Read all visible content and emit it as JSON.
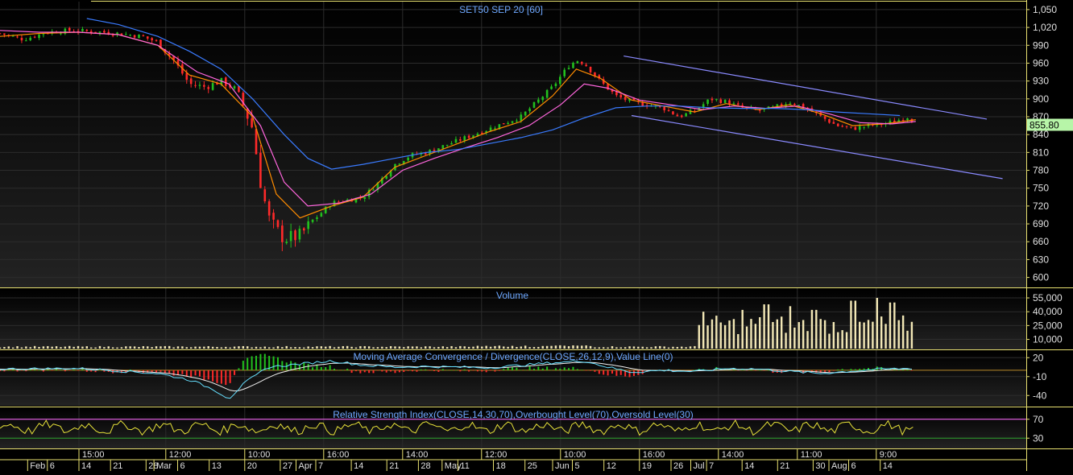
{
  "chart_data": [
    {
      "type": "candlestick",
      "title": "SET50 SEP 20   [60]",
      "last_price": 855.8,
      "last_price_label": "855.80",
      "ylim": [
        590,
        1058
      ],
      "y_ticks": [
        1050,
        1020,
        990,
        960,
        930,
        900,
        870,
        840,
        810,
        780,
        750,
        720,
        690,
        660,
        630,
        600
      ],
      "y_tick_labels": [
        "1,050",
        "1,020",
        "990",
        "960",
        "930",
        "900",
        "870",
        "840",
        "810",
        "780",
        "750",
        "720",
        "690",
        "660",
        "630",
        "600"
      ],
      "close_path": [
        [
          0,
          1010
        ],
        [
          3,
          1000
        ],
        [
          6,
          1012
        ],
        [
          9,
          1015
        ],
        [
          12,
          1013
        ],
        [
          15,
          1010
        ],
        [
          18,
          1005
        ],
        [
          20,
          995
        ],
        [
          22,
          965
        ],
        [
          24,
          925
        ],
        [
          26,
          920
        ],
        [
          28,
          930
        ],
        [
          30,
          915
        ],
        [
          32,
          850
        ],
        [
          33,
          760
        ],
        [
          34,
          700
        ],
        [
          35,
          680
        ],
        [
          36,
          665
        ],
        [
          38,
          670
        ],
        [
          40,
          700
        ],
        [
          42,
          725
        ],
        [
          44,
          730
        ],
        [
          46,
          735
        ],
        [
          48,
          760
        ],
        [
          50,
          790
        ],
        [
          52,
          805
        ],
        [
          54,
          810
        ],
        [
          56,
          820
        ],
        [
          58,
          830
        ],
        [
          60,
          840
        ],
        [
          62,
          850
        ],
        [
          64,
          860
        ],
        [
          66,
          870
        ],
        [
          68,
          895
        ],
        [
          70,
          920
        ],
        [
          72,
          955
        ],
        [
          73,
          965
        ],
        [
          74,
          960
        ],
        [
          76,
          930
        ],
        [
          78,
          905
        ],
        [
          80,
          895
        ],
        [
          82,
          890
        ],
        [
          84,
          885
        ],
        [
          86,
          870
        ],
        [
          88,
          880
        ],
        [
          90,
          900
        ],
        [
          92,
          895
        ],
        [
          94,
          885
        ],
        [
          96,
          880
        ],
        [
          98,
          885
        ],
        [
          100,
          895
        ],
        [
          102,
          885
        ],
        [
          104,
          870
        ],
        [
          106,
          855
        ],
        [
          108,
          850
        ],
        [
          110,
          855
        ],
        [
          112,
          858
        ],
        [
          114,
          865
        ],
        [
          115,
          870
        ],
        [
          116,
          860
        ]
      ],
      "ma_series": [
        {
          "color": "#ff8c00",
          "points": [
            [
              0,
              1005
            ],
            [
              5,
              1010
            ],
            [
              10,
              1012
            ],
            [
              15,
              1008
            ],
            [
              20,
              990
            ],
            [
              24,
              940
            ],
            [
              28,
              925
            ],
            [
              32,
              870
            ],
            [
              35,
              740
            ],
            [
              38,
              700
            ],
            [
              42,
              720
            ],
            [
              46,
              735
            ],
            [
              50,
              785
            ],
            [
              54,
              805
            ],
            [
              58,
              825
            ],
            [
              62,
              845
            ],
            [
              66,
              862
            ],
            [
              70,
              905
            ],
            [
              73,
              950
            ],
            [
              76,
              935
            ],
            [
              80,
              898
            ],
            [
              84,
              888
            ],
            [
              88,
              878
            ],
            [
              92,
              892
            ],
            [
              96,
              882
            ],
            [
              100,
              890
            ],
            [
              104,
              875
            ],
            [
              108,
              855
            ],
            [
              112,
              858
            ],
            [
              116,
              865
            ]
          ]
        },
        {
          "color": "#ff66dd",
          "points": [
            [
              0,
              1015
            ],
            [
              5,
              1012
            ],
            [
              10,
              1012
            ],
            [
              15,
              1008
            ],
            [
              20,
              990
            ],
            [
              25,
              945
            ],
            [
              29,
              925
            ],
            [
              33,
              855
            ],
            [
              36,
              760
            ],
            [
              39,
              720
            ],
            [
              43,
              725
            ],
            [
              47,
              740
            ],
            [
              51,
              780
            ],
            [
              55,
              800
            ],
            [
              59,
              818
            ],
            [
              63,
              835
            ],
            [
              67,
              855
            ],
            [
              71,
              890
            ],
            [
              74,
              925
            ],
            [
              77,
              918
            ],
            [
              81,
              898
            ],
            [
              85,
              890
            ],
            [
              89,
              882
            ],
            [
              93,
              888
            ],
            [
              97,
              884
            ],
            [
              101,
              888
            ],
            [
              105,
              875
            ],
            [
              109,
              860
            ],
            [
              113,
              858
            ],
            [
              116,
              862
            ]
          ]
        },
        {
          "color": "#3a7bff",
          "points": [
            [
              11,
              1035
            ],
            [
              15,
              1025
            ],
            [
              20,
              1005
            ],
            [
              24,
              980
            ],
            [
              28,
              950
            ],
            [
              32,
              900
            ],
            [
              36,
              840
            ],
            [
              39,
              800
            ],
            [
              42,
              782
            ],
            [
              46,
              790
            ],
            [
              50,
              800
            ],
            [
              54,
              810
            ],
            [
              58,
              815
            ],
            [
              62,
              825
            ],
            [
              66,
              835
            ],
            [
              70,
              848
            ],
            [
              74,
              868
            ],
            [
              78,
              885
            ],
            [
              82,
              888
            ],
            [
              86,
              888
            ],
            [
              90,
              885
            ],
            [
              94,
              884
            ],
            [
              98,
              884
            ],
            [
              102,
              882
            ],
            [
              106,
              878
            ],
            [
              110,
              875
            ],
            [
              114,
              872
            ]
          ]
        }
      ],
      "trend_lines": [
        {
          "color": "#8a8aff",
          "from": [
            79,
            972
          ],
          "to": [
            125,
            866
          ]
        },
        {
          "color": "#8a8aff",
          "from": [
            80,
            872
          ],
          "to": [
            127,
            766
          ]
        }
      ]
    },
    {
      "type": "bar",
      "title": "Volume",
      "ylim": [
        0,
        62000
      ],
      "y_ticks": [
        55000,
        40000,
        25000,
        10000
      ],
      "y_tick_labels": [
        "55,000",
        "40,000",
        "25,000",
        "10,000"
      ],
      "base_volume": 2000,
      "active_from": 88,
      "active_level": 28000,
      "active_peaks": [
        [
          89,
          40000
        ],
        [
          94,
          42000
        ],
        [
          97,
          48000
        ],
        [
          100,
          46000
        ],
        [
          103,
          42000
        ],
        [
          108,
          52000
        ],
        [
          111,
          55000
        ],
        [
          113,
          50000
        ],
        [
          116,
          40000
        ]
      ]
    },
    {
      "type": "line",
      "title": "Moving Average Convergence / Divergence(CLOSE,26,12,9),Value Line(0)",
      "ylim": [
        -55,
        28
      ],
      "y_ticks": [
        20,
        -10,
        -40
      ],
      "y_tick_labels": [
        "20",
        "-10",
        "-40"
      ],
      "zero_line": 0,
      "macd_path": [
        [
          0,
          2
        ],
        [
          10,
          3
        ],
        [
          20,
          -5
        ],
        [
          24,
          -15
        ],
        [
          27,
          -30
        ],
        [
          29,
          -45
        ],
        [
          31,
          -20
        ],
        [
          34,
          5
        ],
        [
          38,
          10
        ],
        [
          42,
          15
        ],
        [
          46,
          8
        ],
        [
          50,
          5
        ],
        [
          54,
          6
        ],
        [
          58,
          5
        ],
        [
          62,
          4
        ],
        [
          66,
          8
        ],
        [
          70,
          12
        ],
        [
          74,
          15
        ],
        [
          77,
          5
        ],
        [
          80,
          -3
        ],
        [
          84,
          0
        ],
        [
          88,
          -2
        ],
        [
          92,
          3
        ],
        [
          96,
          2
        ],
        [
          100,
          -2
        ],
        [
          104,
          -5
        ],
        [
          108,
          -1
        ],
        [
          112,
          2
        ],
        [
          116,
          3
        ]
      ]
    },
    {
      "type": "line",
      "title": "Relative Strength Index(CLOSE,14,30,70),Overbought Level(70),Oversold Level(30)",
      "ylim": [
        10,
        90
      ],
      "y_ticks": [
        70,
        30
      ],
      "y_tick_labels": [
        "70",
        "30"
      ],
      "overbought": 70,
      "oversold": 30,
      "rsi_mean": 52,
      "rsi_amplitude": 14
    }
  ],
  "x_axis": {
    "range": [
      0,
      130
    ],
    "time_labels": [
      {
        "x": 10,
        "label": "15:00"
      },
      {
        "x": 21,
        "label": "12:00"
      },
      {
        "x": 31,
        "label": "10:00"
      },
      {
        "x": 41,
        "label": "16:00"
      },
      {
        "x": 51,
        "label": "14:00"
      },
      {
        "x": 61,
        "label": "12:00"
      },
      {
        "x": 71,
        "label": "10:00"
      },
      {
        "x": 81,
        "label": "16:00"
      },
      {
        "x": 91,
        "label": "14:00"
      },
      {
        "x": 101,
        "label": "11:00"
      },
      {
        "x": 111,
        "label": "9:00"
      }
    ],
    "date_labels": [
      {
        "x": 3.5,
        "label": "Feb"
      },
      {
        "x": 6,
        "label": "6"
      },
      {
        "x": 10,
        "label": "14"
      },
      {
        "x": 14,
        "label": "21"
      },
      {
        "x": 18.5,
        "label": "28"
      },
      {
        "x": 19.5,
        "label": "Mar"
      },
      {
        "x": 22.5,
        "label": "6"
      },
      {
        "x": 26.5,
        "label": "13"
      },
      {
        "x": 31,
        "label": "20"
      },
      {
        "x": 35.5,
        "label": "27"
      },
      {
        "x": 37.5,
        "label": "Apr"
      },
      {
        "x": 40,
        "label": "7"
      },
      {
        "x": 44.5,
        "label": "14"
      },
      {
        "x": 49,
        "label": "21"
      },
      {
        "x": 53,
        "label": "28"
      },
      {
        "x": 56,
        "label": "May"
      },
      {
        "x": 58,
        "label": "11"
      },
      {
        "x": 62.5,
        "label": "18"
      },
      {
        "x": 66.5,
        "label": "25"
      },
      {
        "x": 70,
        "label": "Jun"
      },
      {
        "x": 72.5,
        "label": "5"
      },
      {
        "x": 76.5,
        "label": "12"
      },
      {
        "x": 81,
        "label": "19"
      },
      {
        "x": 85,
        "label": "26"
      },
      {
        "x": 87.5,
        "label": "Jul"
      },
      {
        "x": 89.5,
        "label": "7"
      },
      {
        "x": 94,
        "label": "14"
      },
      {
        "x": 98.5,
        "label": "21"
      },
      {
        "x": 103,
        "label": "30"
      },
      {
        "x": 105,
        "label": "Aug"
      },
      {
        "x": 107.5,
        "label": "6"
      },
      {
        "x": 111.5,
        "label": "14"
      }
    ]
  },
  "colors": {
    "background": "#000000",
    "panel_border": "#e8e070",
    "grid": "#2c2c2c",
    "axis_text": "#e0e0e0",
    "title_text": "#6ea8ff",
    "candle_up": "#22c01e",
    "candle_down": "#ff2a2a",
    "price_box": "#b7f5a8",
    "volume": "#f3e8b6",
    "macd_line": "#66e0ff",
    "macd_signal": "#f0f0f0",
    "macd_hist_up": "#22c01e",
    "macd_hist_down": "#ff2a2a",
    "rsi_line": "#e8e23a",
    "rsi_levels": "#ff66ff"
  }
}
